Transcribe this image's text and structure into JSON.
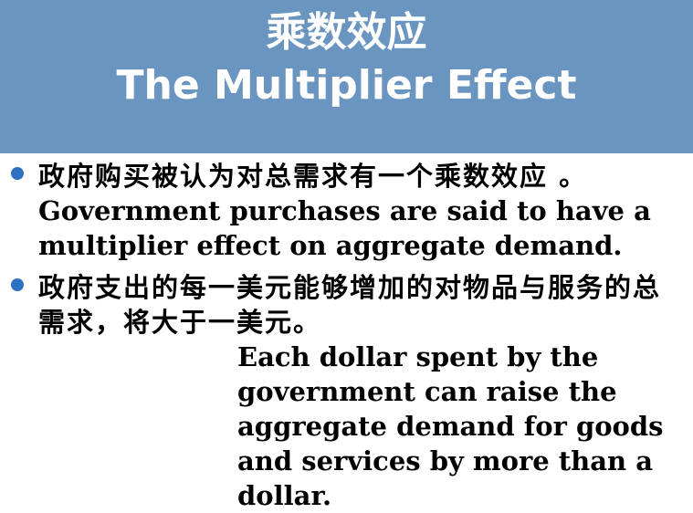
{
  "slide": {
    "title_cn": "乘数效应",
    "title_en": "The Multiplier Effect",
    "bullets": [
      {
        "text_cn": "政府购买被认为对总需求有一个乘数效应 。",
        "text_en": "Government purchases are said to have a multiplier effect on aggregate demand."
      },
      {
        "text_cn": "政府支出的每一美元能够增加的对物品与服务的总需求，将大于一美元。",
        "text_en": "Each dollar spent by the government can raise the aggregate demand for goods and services by more than a dollar."
      }
    ]
  },
  "colors": {
    "title_band": "#6a95c0",
    "title_text": "#ffffff",
    "bullet": "#2f71c1",
    "body_text": "#000000"
  }
}
